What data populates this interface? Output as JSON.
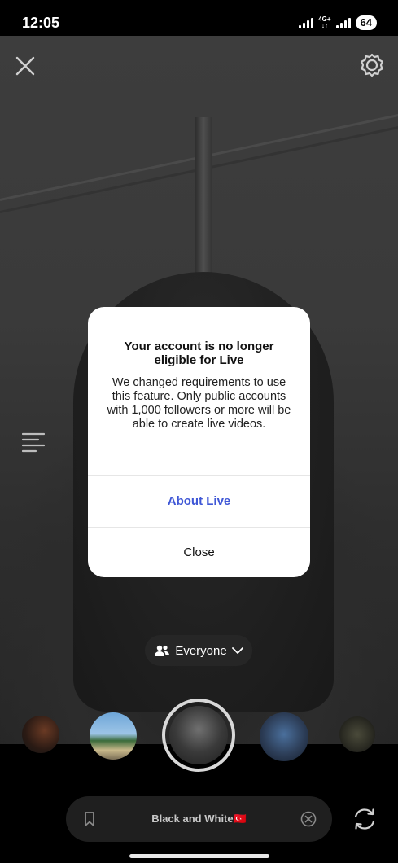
{
  "status_bar": {
    "time": "12:05",
    "network_top": "4G+",
    "network_bottom": "↓↑",
    "battery": "64"
  },
  "camera": {
    "close_icon": "close-icon",
    "settings_icon": "gear-icon",
    "menu_icon": "menu-lines-icon"
  },
  "modal": {
    "title": "Your account is no longer eligible for Live",
    "body": "We changed requirements to use this feature. Only public accounts with 1,000 followers or more will be able to create live videos.",
    "primary_action": "About Live",
    "secondary_action": "Close",
    "primary_color": "#3f57d6"
  },
  "audience": {
    "icon": "people-icon",
    "label": "Everyone",
    "chevron": "chevron-down-icon"
  },
  "effects": {
    "current_effect": "Black and White🇹🇷",
    "bookmark_icon": "bookmark-icon",
    "clear_icon": "close-circle-icon",
    "flip_icon": "flip-camera-icon"
  }
}
